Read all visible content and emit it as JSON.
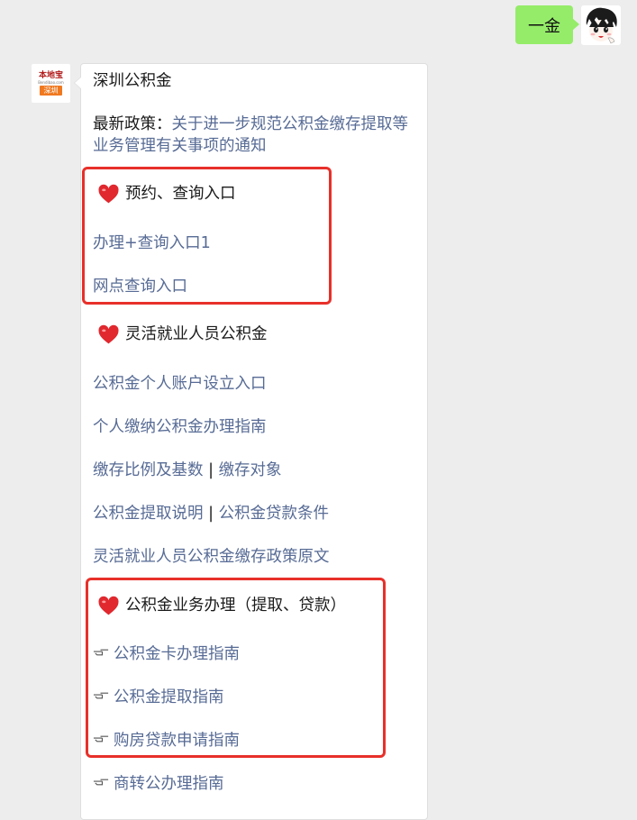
{
  "user_message": {
    "text": "一金"
  },
  "bot": {
    "logo": {
      "brand": "本地宝",
      "sub": "Bendibao.com",
      "city": "深圳"
    }
  },
  "card": {
    "title": "深圳公积金",
    "policy": {
      "label": "最新政策：",
      "link_line1": "关于进一步规范公积金缴存提取等",
      "link_line2": "业务管理有关事项的通知"
    },
    "sections": [
      {
        "heading": "预约、查询入口",
        "links": [
          "办理+查询入口1",
          "网点查询入口"
        ]
      },
      {
        "heading": "灵活就业人员公积金",
        "links": [
          "公积金个人账户设立入口",
          "个人缴纳公积金办理指南",
          "缴存比例及基数",
          "缴存对象",
          "公积金提取说明",
          "公积金贷款条件",
          "灵活就业人员公积金缴存政策原文"
        ],
        "separator": "|"
      },
      {
        "heading": "公积金业务办理（提取、贷款）",
        "links": [
          "公积金卡办理指南",
          "公积金提取指南",
          "购房贷款申请指南",
          "商转公办理指南"
        ]
      }
    ]
  },
  "colors": {
    "link": "#576b95",
    "highlight_box": "#e8302a",
    "user_bubble": "#95ec69",
    "heart": "#e0282e"
  },
  "icons": {
    "heart": "heart-icon",
    "pointer": "pointing-hand-icon"
  }
}
